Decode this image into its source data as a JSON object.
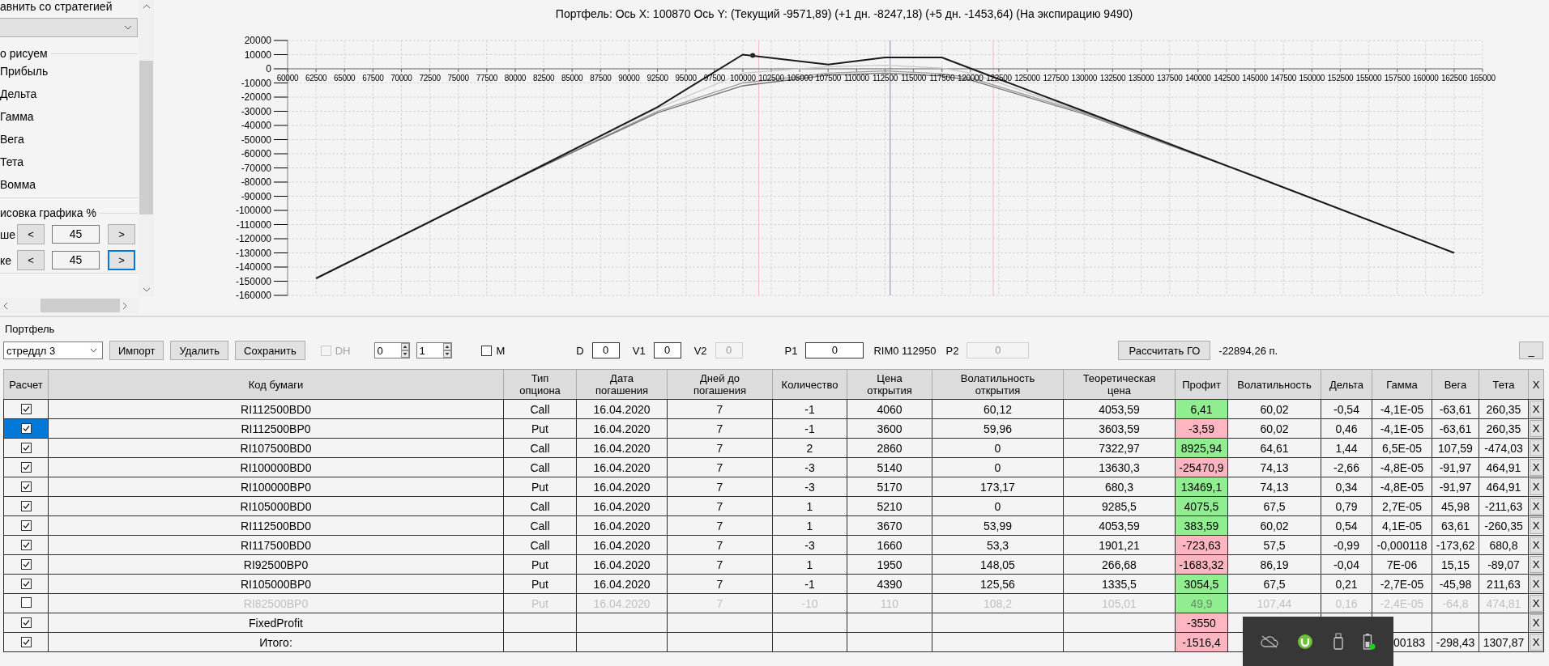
{
  "left_panel": {
    "compare_label": "авнить со стратегией",
    "draw_group": {
      "title": "о рисуем",
      "items": [
        "Прибыль",
        "Дельта",
        "Гамма",
        "Вега",
        "Тета",
        "Вомма"
      ]
    },
    "scale_group": {
      "title": "исовка графика %",
      "rows": [
        {
          "label": "ше",
          "dec": "<",
          "value": "45",
          "inc": ">",
          "focused": false
        },
        {
          "label": "ке",
          "dec": "<",
          "value": "45",
          "inc": ">",
          "focused": true
        }
      ]
    }
  },
  "chart": {
    "chart_data": {
      "type": "line",
      "title": "Портфель: Ось X: 100870 Ось Y:  (Текущий -9571,89)  (+1 дн. -8247,18)  (+5 дн. -1453,64)  (На экспирацию 9490)",
      "x": [
        62500,
        80000,
        92500,
        100000,
        107500,
        112500,
        117500,
        120000,
        130000,
        145000,
        162500
      ],
      "xlim": [
        60000,
        165000
      ],
      "ylim": [
        -160000,
        20000
      ],
      "series": [
        {
          "color": "#c8c8c8",
          "values": [
            -148000,
            -77000,
            -28000,
            -3000,
            1500,
            2500,
            500,
            -3000,
            -30500,
            -76000,
            -130000
          ]
        },
        {
          "color": "#9a9a9a",
          "values": [
            -148000,
            -78000,
            -30000,
            -10000,
            -3000,
            -1500,
            -3500,
            -6500,
            -31000,
            -76000,
            -130000
          ]
        },
        {
          "color": "#707070",
          "values": [
            -148000,
            -78000,
            -31000,
            -12000,
            -4500,
            -3000,
            -5000,
            -8000,
            -32000,
            -76000,
            -130000
          ]
        },
        {
          "color": "#1a1a1a",
          "values": [
            -148000,
            -78000,
            -27000,
            10000,
            3000,
            8000,
            8000,
            300,
            -30000,
            -76000,
            -130000
          ]
        }
      ],
      "xticks": [
        60000,
        62500,
        65000,
        67500,
        70000,
        72500,
        75000,
        77500,
        80000,
        82500,
        85000,
        87500,
        90000,
        92500,
        95000,
        97500,
        100000,
        102500,
        105000,
        107500,
        110000,
        112500,
        115000,
        117500,
        120000,
        122500,
        125000,
        127500,
        130000,
        132500,
        135000,
        137500,
        140000,
        142500,
        145000,
        147500,
        150000,
        152500,
        155000,
        157500,
        160000,
        162500,
        165000
      ],
      "yticks": [
        20000,
        10000,
        0,
        -10000,
        -20000,
        -30000,
        -40000,
        -50000,
        -60000,
        -70000,
        -80000,
        -90000,
        -100000,
        -110000,
        -120000,
        -130000,
        -140000,
        -150000,
        -160000
      ],
      "grid": true,
      "ref_lines": [
        {
          "axis": "x",
          "value": 101400,
          "color": "#f2b8c6"
        },
        {
          "axis": "x",
          "value": 112950,
          "color": "#8090b0"
        },
        {
          "axis": "x",
          "value": 122000,
          "color": "#f2b8c6"
        }
      ]
    }
  },
  "portfolio": {
    "title": "Портфель",
    "strategy": "стреддл 3",
    "buttons": [
      "Импорт",
      "Удалить",
      "Сохранить"
    ],
    "dh": {
      "label": "DH",
      "checked": false,
      "disabled": true
    },
    "spinners": [
      "0",
      "1"
    ],
    "m": {
      "label": "M",
      "checked": false
    },
    "fields": [
      {
        "kind": "field",
        "label": "D",
        "value": "0",
        "disabled": false
      },
      {
        "kind": "field",
        "label": "V1",
        "value": "0",
        "disabled": false
      },
      {
        "kind": "field",
        "label": "V2",
        "value": "0",
        "disabled": true
      },
      {
        "kind": "field",
        "label": "P1",
        "value": "0",
        "disabled": false
      },
      {
        "kind": "text",
        "text": "RIM0 112950"
      },
      {
        "kind": "field",
        "label": "P2",
        "value": "0",
        "disabled": true
      }
    ],
    "calc_button": "Рассчитать ГО",
    "go_value": "-22894,26 п.",
    "minimize_button": "_"
  },
  "table": {
    "columns": [
      "Расчет",
      "Код бумаги",
      "Тип\nопциона",
      "Дата\nпогашения",
      "Дней до\nпогашения",
      "Количество",
      "Цена\nоткрытия",
      "Волатильность\nоткрытия",
      "Теоретическая\nцена",
      "Профит",
      "Волатильность",
      "Дельта",
      "Гамма",
      "Вега",
      "Тета",
      "X"
    ],
    "rows": [
      {
        "kind": "option",
        "checked": true,
        "selected": false,
        "disabled": false,
        "code": "RI112500BD0",
        "type": "Call",
        "date": "16.04.2020",
        "days": "7",
        "qty": "-1",
        "price": "4060",
        "vol_open": "60,12",
        "theor": "4053,59",
        "profit": "6,41",
        "color": "#90ee90",
        "vol": "60,02",
        "delta": "-0,54",
        "gamma": "-4,1E-05",
        "vega": "-63,61",
        "theta": "260,35",
        "delete": "X"
      },
      {
        "kind": "option",
        "checked": true,
        "selected": true,
        "disabled": false,
        "code": "RI112500BP0",
        "type": "Put",
        "date": "16.04.2020",
        "days": "7",
        "qty": "-1",
        "price": "3600",
        "vol_open": "59,96",
        "theor": "3603,59",
        "profit": "-3,59",
        "color": "#ffb6c1",
        "vol": "60,02",
        "delta": "0,46",
        "gamma": "-4,1E-05",
        "vega": "-63,61",
        "theta": "260,35",
        "delete": "X"
      },
      {
        "kind": "option",
        "checked": true,
        "selected": false,
        "disabled": false,
        "code": "RI107500BD0",
        "type": "Call",
        "date": "16.04.2020",
        "days": "7",
        "qty": "2",
        "price": "2860",
        "vol_open": "0",
        "theor": "7322,97",
        "profit": "8925,94",
        "color": "#90ee90",
        "vol": "64,61",
        "delta": "1,44",
        "gamma": "6,5E-05",
        "vega": "107,59",
        "theta": "-474,03",
        "delete": "X"
      },
      {
        "kind": "option",
        "checked": true,
        "selected": false,
        "disabled": false,
        "code": "RI100000BD0",
        "type": "Call",
        "date": "16.04.2020",
        "days": "7",
        "qty": "-3",
        "price": "5140",
        "vol_open": "0",
        "theor": "13630,3",
        "profit": "-25470,9",
        "color": "#ffb6c1",
        "vol": "74,13",
        "delta": "-2,66",
        "gamma": "-4,8E-05",
        "vega": "-91,97",
        "theta": "464,91",
        "delete": "X"
      },
      {
        "kind": "option",
        "checked": true,
        "selected": false,
        "disabled": false,
        "code": "RI100000BP0",
        "type": "Put",
        "date": "16.04.2020",
        "days": "7",
        "qty": "-3",
        "price": "5170",
        "vol_open": "173,17",
        "theor": "680,3",
        "profit": "13469,1",
        "color": "#90ee90",
        "vol": "74,13",
        "delta": "0,34",
        "gamma": "-4,8E-05",
        "vega": "-91,97",
        "theta": "464,91",
        "delete": "X"
      },
      {
        "kind": "option",
        "checked": true,
        "selected": false,
        "disabled": false,
        "code": "RI105000BD0",
        "type": "Call",
        "date": "16.04.2020",
        "days": "7",
        "qty": "1",
        "price": "5210",
        "vol_open": "0",
        "theor": "9285,5",
        "profit": "4075,5",
        "color": "#90ee90",
        "vol": "67,5",
        "delta": "0,79",
        "gamma": "2,7E-05",
        "vega": "45,98",
        "theta": "-211,63",
        "delete": "X"
      },
      {
        "kind": "option",
        "checked": true,
        "selected": false,
        "disabled": false,
        "code": "RI112500BD0",
        "type": "Call",
        "date": "16.04.2020",
        "days": "7",
        "qty": "1",
        "price": "3670",
        "vol_open": "53,99",
        "theor": "4053,59",
        "profit": "383,59",
        "color": "#90ee90",
        "vol": "60,02",
        "delta": "0,54",
        "gamma": "4,1E-05",
        "vega": "63,61",
        "theta": "-260,35",
        "delete": "X"
      },
      {
        "kind": "option",
        "checked": true,
        "selected": false,
        "disabled": false,
        "code": "RI117500BD0",
        "type": "Call",
        "date": "16.04.2020",
        "days": "7",
        "qty": "-3",
        "price": "1660",
        "vol_open": "53,3",
        "theor": "1901,21",
        "profit": "-723,63",
        "color": "#ffb6c1",
        "vol": "57,5",
        "delta": "-0,99",
        "gamma": "-0,000118",
        "vega": "-173,62",
        "theta": "680,8",
        "delete": "X"
      },
      {
        "kind": "option",
        "checked": true,
        "selected": false,
        "disabled": false,
        "code": "RI92500BP0",
        "type": "Put",
        "date": "16.04.2020",
        "days": "7",
        "qty": "1",
        "price": "1950",
        "vol_open": "148,05",
        "theor": "266,68",
        "profit": "-1683,32",
        "color": "#ffb6c1",
        "vol": "86,19",
        "delta": "-0,04",
        "gamma": "7E-06",
        "vega": "15,15",
        "theta": "-89,07",
        "delete": "X"
      },
      {
        "kind": "option",
        "checked": true,
        "selected": false,
        "disabled": false,
        "code": "RI105000BP0",
        "type": "Put",
        "date": "16.04.2020",
        "days": "7",
        "qty": "-1",
        "price": "4390",
        "vol_open": "125,56",
        "theor": "1335,5",
        "profit": "3054,5",
        "color": "#90ee90",
        "vol": "67,5",
        "delta": "0,21",
        "gamma": "-2,7E-05",
        "vega": "-45,98",
        "theta": "211,63",
        "delete": "X"
      },
      {
        "kind": "option",
        "checked": false,
        "selected": false,
        "disabled": true,
        "code": "RI82500BP0",
        "type": "Put",
        "date": "16.04.2020",
        "days": "7",
        "qty": "-10",
        "price": "110",
        "vol_open": "108,2",
        "theor": "105,01",
        "profit": "49,9",
        "color": "#90ee90",
        "vol": "107,44",
        "delta": "0,16",
        "gamma": "-2,4E-05",
        "vega": "-64,8",
        "theta": "474,81",
        "delete": "X"
      },
      {
        "kind": "fixed",
        "checked": true,
        "selected": false,
        "disabled": false,
        "code": "FixedProfit",
        "profit": "-3550",
        "color": "#ffb6c1",
        "delete": "X"
      },
      {
        "kind": "total",
        "checked": true,
        "selected": false,
        "disabled": false,
        "code": "Итого:",
        "profit": "-1516,4",
        "color": "#ffb6c1",
        "gamma": "00183",
        "vega": "-298,43",
        "theta": "1307,87",
        "delete": "X"
      }
    ]
  }
}
